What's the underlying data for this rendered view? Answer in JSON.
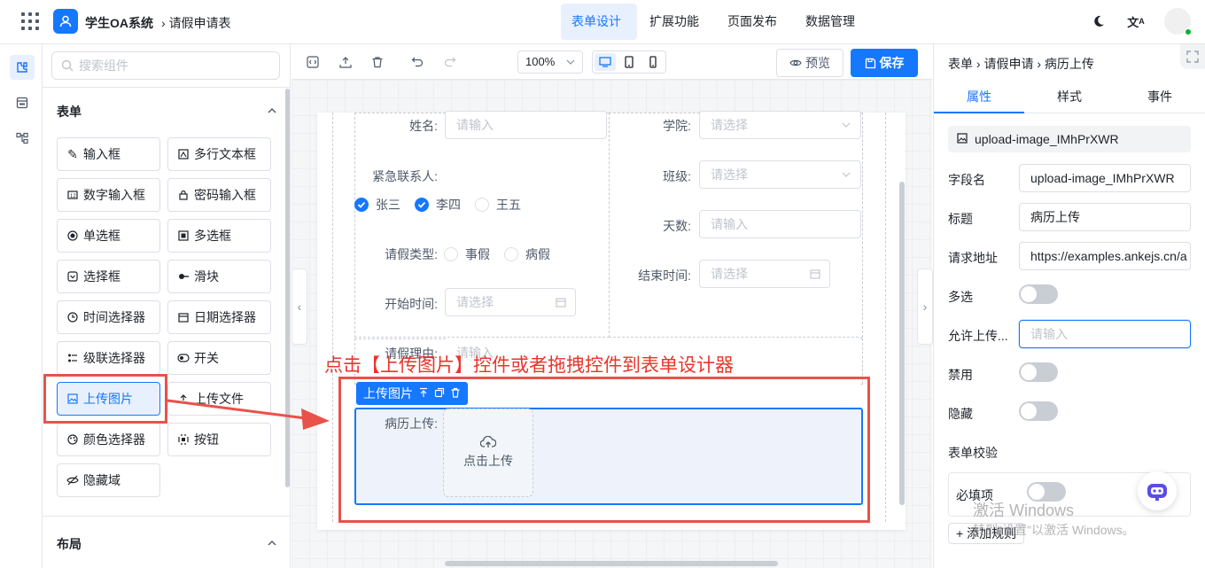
{
  "header": {
    "app_name": "学生OA系统",
    "breadcrumb": "请假申请表",
    "nav_tabs": [
      {
        "label": "表单设计",
        "active": true
      },
      {
        "label": "扩展功能",
        "active": false
      },
      {
        "label": "页面发布",
        "active": false
      },
      {
        "label": "数据管理",
        "active": false
      }
    ],
    "icons": [
      "apps-grid-icon",
      "moon-icon",
      "translate-icon",
      "user-avatar"
    ]
  },
  "left_rail": {
    "icons": [
      "components-icon",
      "outline-icon",
      "tree-icon"
    ]
  },
  "component_panel": {
    "search_placeholder": "搜索组件",
    "form_section": {
      "title": "表单",
      "items": [
        {
          "label": "输入框",
          "icon": "edit-icon"
        },
        {
          "label": "多行文本框",
          "icon": "textarea-icon"
        },
        {
          "label": "数字输入框",
          "icon": "number-icon"
        },
        {
          "label": "密码输入框",
          "icon": "lock-icon"
        },
        {
          "label": "单选框",
          "icon": "radio-icon"
        },
        {
          "label": "多选框",
          "icon": "checkbox-icon"
        },
        {
          "label": "选择框",
          "icon": "select-icon"
        },
        {
          "label": "滑块",
          "icon": "slider-icon"
        },
        {
          "label": "时间选择器",
          "icon": "clock-icon"
        },
        {
          "label": "日期选择器",
          "icon": "calendar-icon"
        },
        {
          "label": "级联选择器",
          "icon": "cascader-icon"
        },
        {
          "label": "开关",
          "icon": "switch-icon"
        },
        {
          "label": "上传图片",
          "icon": "image-icon",
          "selected": true
        },
        {
          "label": "上传文件",
          "icon": "upload-icon"
        },
        {
          "label": "颜色选择器",
          "icon": "palette-icon"
        },
        {
          "label": "按钮",
          "icon": "button-icon"
        },
        {
          "label": "隐藏域",
          "icon": "eye-off-icon"
        }
      ]
    },
    "layout_section": {
      "title": "布局"
    }
  },
  "toolbar": {
    "zoom": "100%",
    "preview_label": "预览",
    "save_label": "保存",
    "devices": [
      "desktop",
      "tablet",
      "mobile"
    ],
    "active_device": "desktop"
  },
  "form": {
    "name_label": "姓名:",
    "name_placeholder": "请输入",
    "college_label": "学院:",
    "college_placeholder": "请选择",
    "contact_label": "紧急联系人:",
    "contacts": [
      {
        "label": "张三",
        "checked": true
      },
      {
        "label": "李四",
        "checked": true
      },
      {
        "label": "王五",
        "checked": false
      }
    ],
    "class_label": "班级:",
    "class_placeholder": "请选择",
    "days_label": "天数:",
    "days_placeholder": "请输入",
    "leave_type_label": "请假类型:",
    "leave_types": [
      {
        "label": "事假",
        "checked": false
      },
      {
        "label": "病假",
        "checked": false
      }
    ],
    "end_time_label": "结束时间:",
    "end_time_placeholder": "请选择",
    "start_time_label": "开始时间:",
    "start_time_placeholder": "请选择",
    "reason_label": "请假理由:",
    "reason_placeholder": "请输入",
    "selected_widget_tag": "上传图片",
    "medical_label": "病历上传:",
    "upload_text": "点击上传"
  },
  "annotation": "点击【上传图片】控件或者拖拽控件到表单设计器",
  "properties": {
    "breadcrumb": [
      "表单",
      "请假申请",
      "病历上传"
    ],
    "tabs": [
      {
        "label": "属性",
        "active": true
      },
      {
        "label": "样式",
        "active": false
      },
      {
        "label": "事件",
        "active": false
      }
    ],
    "widget_id": "upload-image_IMhPrXWR",
    "field_name_label": "字段名",
    "field_name_value": "upload-image_IMhPrXWR",
    "title_label": "标题",
    "title_value": "病历上传",
    "url_label": "请求地址",
    "url_value": "https://examples.ankejs.cn/a",
    "multiple_label": "多选",
    "multiple_on": false,
    "allow_label": "允许上传...",
    "allow_placeholder": "请输入",
    "disabled_label": "禁用",
    "disabled_on": false,
    "hidden_label": "隐藏",
    "hidden_on": false,
    "validation_label": "表单校验",
    "required_label": "必填项",
    "required_on": false,
    "add_rule_label": "+ 添加规则"
  },
  "watermark": {
    "line1": "激活 Windows",
    "line2": "转到\"设置\"以激活 Windows。"
  },
  "colors": {
    "accent": "#1677ff",
    "annotation_red": "#e8352b"
  }
}
